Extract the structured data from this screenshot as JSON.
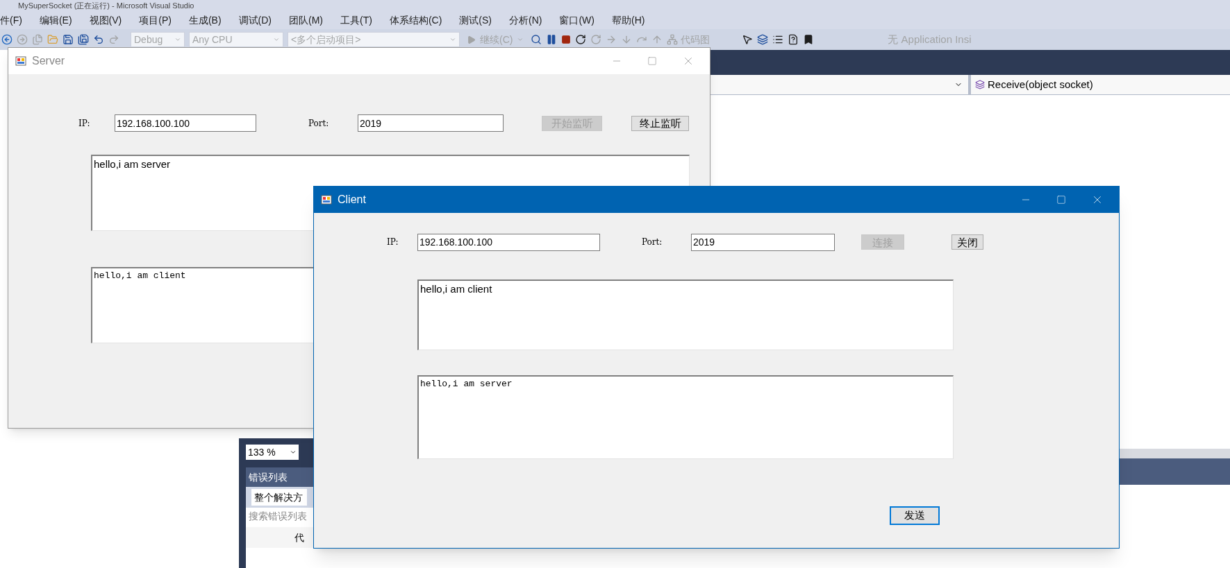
{
  "ide": {
    "title": "MySuperSocket (正在运行) - Microsoft Visual Studio",
    "menu": [
      "件(F)",
      "编辑(E)",
      "视图(V)",
      "项目(P)",
      "生成(B)",
      "调试(D)",
      "团队(M)",
      "工具(T)",
      "体系结构(C)",
      "测试(S)",
      "分析(N)",
      "窗口(W)",
      "帮助(H)"
    ],
    "toolbar": {
      "configuration": "Debug",
      "platform": "Any CPU",
      "startup": "<多个启动项目>",
      "continue": "继续(C)",
      "code_map": "代码图",
      "insights": "无 Application Insi"
    },
    "navigation": {
      "member": "Receive(object socket)"
    },
    "zoom": "133 %",
    "error_list": {
      "title": "错误列表",
      "scope": "整个解决方",
      "search_placeholder": "搜索错误列表",
      "column": "代"
    }
  },
  "windows": [
    {
      "title": "Server",
      "active": false,
      "ip_label": "IP:",
      "ip": "192.168.100.100",
      "port_label": "Port:",
      "port": "2019",
      "buttons": [
        {
          "label": "开始监听",
          "disabled": true
        },
        {
          "label": "终止监听",
          "disabled": false
        }
      ],
      "message": "hello,i am server",
      "log": "hello,i am client"
    },
    {
      "title": "Client",
      "active": true,
      "ip_label": "IP:",
      "ip": "192.168.100.100",
      "port_label": "Port:",
      "port": "2019",
      "buttons": [
        {
          "label": "连接",
          "disabled": true
        },
        {
          "label": "关闭",
          "disabled": false
        }
      ],
      "message": "hello,i am client",
      "log": "hello,i am server",
      "send": {
        "label": "发送",
        "focused": true
      }
    }
  ]
}
